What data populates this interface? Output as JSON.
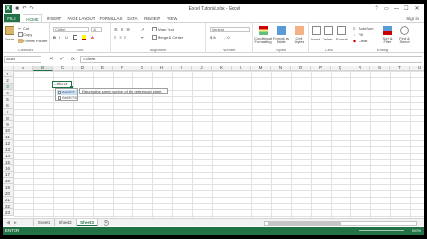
{
  "window": {
    "title": "Excel Tutorial.xlsx - Excel",
    "controls": [
      "?",
      "▭",
      "—",
      "☐",
      "✕"
    ]
  },
  "tabs": [
    "FILE",
    "HOME",
    "INSERT",
    "PAGE LAYOUT",
    "FORMULAS",
    "DATA",
    "REVIEW",
    "VIEW"
  ],
  "signin": "Sign in",
  "ribbon": {
    "clipboard": {
      "paste": "Paste",
      "cut": "Cut",
      "copy": "Copy",
      "format_painter": "Format Painter",
      "label": "Clipboard"
    },
    "font": {
      "font_name": "Calibri",
      "font_size": "11",
      "label": "Font"
    },
    "alignment": {
      "wrap_text": "Wrap Text",
      "merge_center": "Merge & Center",
      "label": "Alignment"
    },
    "number": {
      "format": "General",
      "label": "Number"
    },
    "styles": {
      "conditional": "Conditional Formatting",
      "format_table": "Format as Table",
      "cell_styles": "Cell Styles",
      "label": "Styles"
    },
    "cells": {
      "insert": "Insert",
      "delete": "Delete",
      "format": "Format",
      "label": "Cells"
    },
    "editing": {
      "autosum": "AutoSum",
      "fill": "Fill",
      "clear": "Clear",
      "sort_filter": "Sort & Filter",
      "find_select": "Find & Select",
      "label": "Editing"
    }
  },
  "formula_bar": {
    "name_box": "SUM",
    "cancel": "✕",
    "enter": "✓",
    "fx": "fx",
    "content": "=Sheet"
  },
  "grid": {
    "columns": [
      "A",
      "B",
      "C",
      "D",
      "E",
      "F",
      "G",
      "H",
      "I",
      "J",
      "K",
      "L",
      "M",
      "N",
      "O",
      "P",
      "Q",
      "R",
      "S",
      "T",
      "U"
    ],
    "rows": [
      "1",
      "2",
      "3",
      "4",
      "5",
      "6",
      "7",
      "8",
      "9",
      "10",
      "11",
      "12",
      "13",
      "14",
      "15",
      "16",
      "17",
      "18",
      "19",
      "20",
      "21",
      "22",
      "23"
    ],
    "active_cell_text": "=Sheet",
    "autocomplete": [
      "SHEET",
      "SHEETS"
    ],
    "tooltip": "Returns the sheet number of the referenced sheet"
  },
  "sheets": {
    "tabs": [
      "Sheet1",
      "Sheet2",
      "Sheet3"
    ],
    "add": "+"
  },
  "status": {
    "mode": "ENTER",
    "zoom": "100%"
  }
}
